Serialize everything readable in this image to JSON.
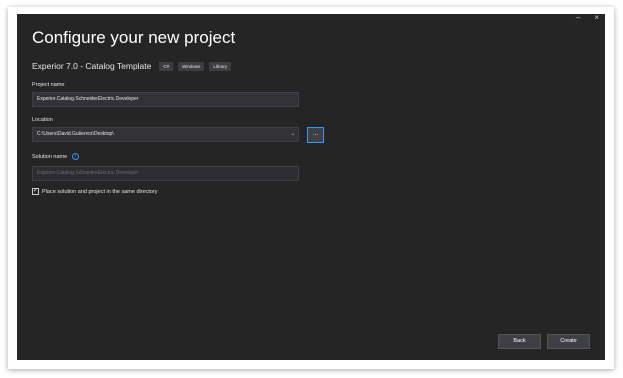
{
  "window": {
    "minimize_glyph": "–",
    "close_glyph": "×"
  },
  "header": {
    "title": "Configure your new project",
    "template_name": "Experior 7.0 - Catalog Template",
    "tags": [
      "C#",
      "Windows",
      "Library"
    ]
  },
  "form": {
    "project_name_label": "Project name",
    "project_name_value": "Experior.Catalog.SchneiderElectric.Developer",
    "location_label": "Location",
    "location_value": "C:\\Users\\David.Gutierrez\\Desktop\\",
    "browse_label": "...",
    "solution_name_label": "Solution name",
    "solution_name_value": "Experior.Catalog.SchneiderElectric.Developer",
    "same_directory_label": "Place solution and project in the same directory",
    "same_directory_checked": true
  },
  "footer": {
    "back_label": "Back",
    "create_label": "Create"
  }
}
